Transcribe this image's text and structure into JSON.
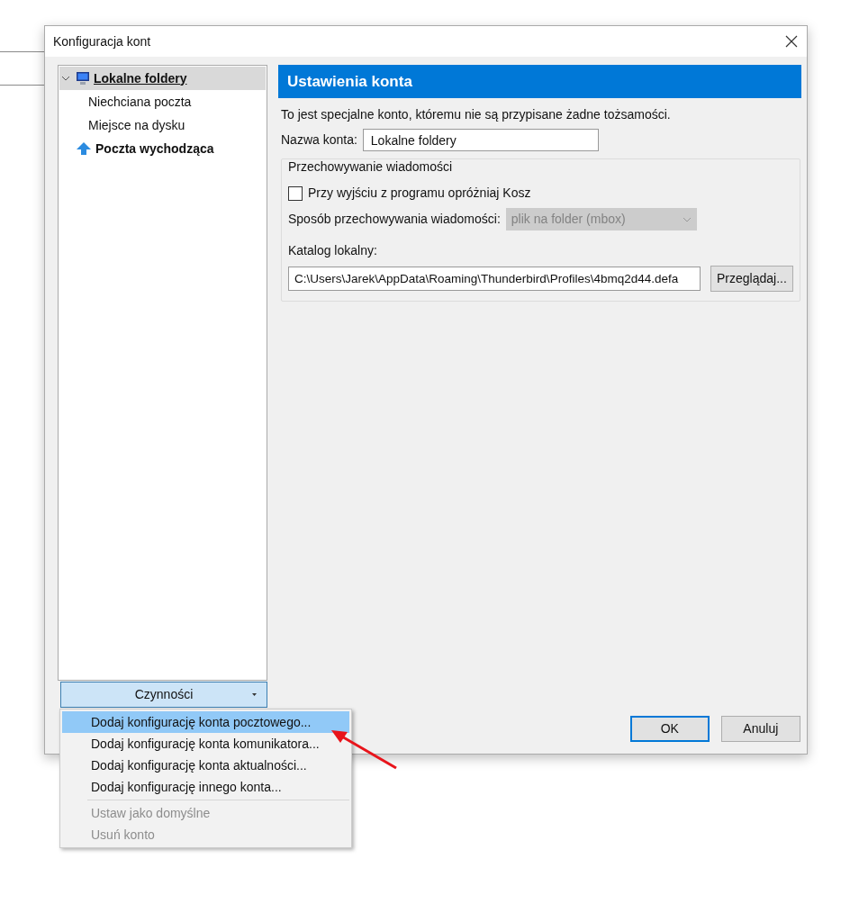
{
  "window": {
    "title": "Konfiguracja kont"
  },
  "tree": [
    {
      "label": "Lokalne foldery",
      "kind": "local",
      "selected": true,
      "expanded": true,
      "children": [
        {
          "label": "Niechciana poczta",
          "selected": false
        },
        {
          "label": "Miejsce na dysku",
          "selected": false
        }
      ]
    },
    {
      "label": "Poczta wychodząca",
      "kind": "outgoing",
      "selected": false
    }
  ],
  "actions_button": {
    "label": "Czynności"
  },
  "panel": {
    "header": "Ustawienia konta",
    "description": "To jest specjalne konto, któremu nie są przypisane żadne tożsamości.",
    "account_name": {
      "label": "Nazwa konta:",
      "value": "Lokalne foldery"
    },
    "storage": {
      "legend": "Przechowywanie wiadomości",
      "empty_trash": {
        "label": "Przy wyjściu z programu opróżniaj Kosz",
        "checked": false
      },
      "store_type": {
        "label": "Sposób przechowywania wiadomości:",
        "value": "plik na folder (mbox)",
        "disabled": true
      },
      "local_dir": {
        "label": "Katalog lokalny:",
        "value": "C:\\Users\\Jarek\\AppData\\Roaming\\Thunderbird\\Profiles\\4bmq2d44.defa",
        "button": "Przeglądaj..."
      }
    }
  },
  "buttons": [
    {
      "label": "OK",
      "default": true
    },
    {
      "label": "Anuluj",
      "default": false
    }
  ],
  "menu": [
    [
      {
        "label": "Dodaj konfigurację konta pocztowego...",
        "selected": true,
        "disabled": false
      },
      {
        "label": "Dodaj konfigurację konta komunikatora...",
        "selected": false,
        "disabled": false
      },
      {
        "label": "Dodaj konfigurację konta aktualności...",
        "selected": false,
        "disabled": false
      },
      {
        "label": "Dodaj konfigurację innego konta...",
        "selected": false,
        "disabled": false
      }
    ],
    [
      {
        "label": "Ustaw jako domyślne",
        "selected": false,
        "disabled": true
      },
      {
        "label": "Usuń konto",
        "selected": false,
        "disabled": true
      }
    ]
  ]
}
